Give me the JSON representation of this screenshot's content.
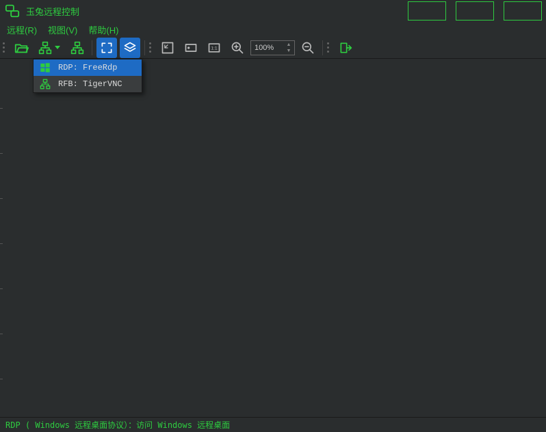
{
  "title": "玉兔远程控制",
  "menubar": {
    "remote": "远程(R)",
    "view": "视图(V)",
    "help": "帮助(H)"
  },
  "toolbar": {
    "zoom_value": "100%"
  },
  "dropdown": {
    "items": [
      {
        "label": "RDP: FreeRdp",
        "icon": "windows-icon",
        "selected": true
      },
      {
        "label": "RFB: TigerVNC",
        "icon": "network-icon",
        "selected": false
      }
    ]
  },
  "statusbar": {
    "text": "RDP ( Windows 远程桌面协议）：访问 Windows 远程桌面"
  }
}
